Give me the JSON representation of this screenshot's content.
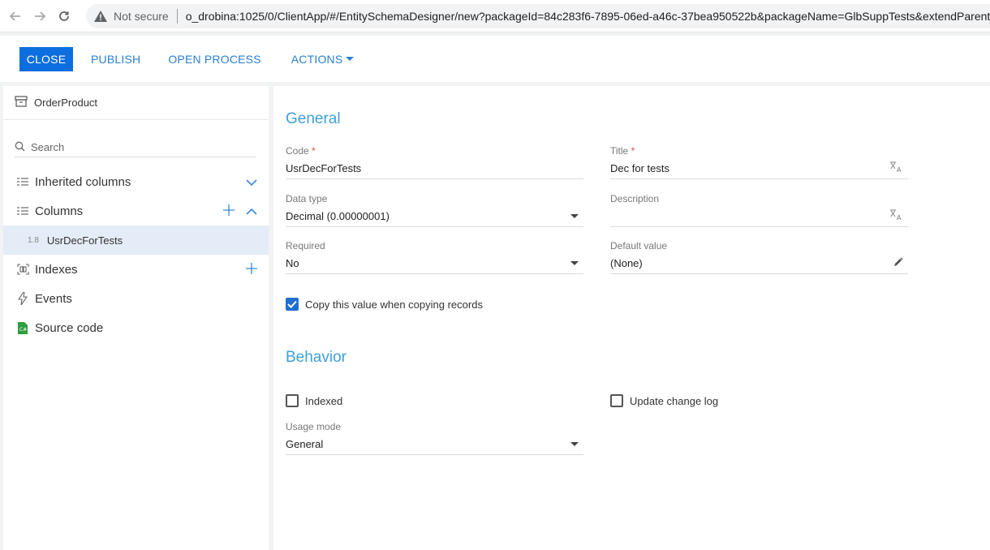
{
  "browser": {
    "not_secure_label": "Not secure",
    "url": "o_drobina:1025/0/ClientApp/#/EntitySchemaDesigner/new?packageId=84c283f6-7895-06ed-a46c-37bea950522b&packageName=GlbSuppTests&extendParent="
  },
  "toolbar": {
    "close_label": "CLOSE",
    "publish_label": "PUBLISH",
    "open_process_label": "OPEN PROCESS",
    "actions_label": "ACTIONS"
  },
  "sidebar": {
    "object_name": "OrderProduct",
    "search_placeholder": "Search",
    "items": [
      {
        "label": "Inherited columns"
      },
      {
        "label": "Columns"
      },
      {
        "label": "Indexes"
      },
      {
        "label": "Events"
      },
      {
        "label": "Source code"
      }
    ],
    "selected_column": {
      "number": "1.8",
      "label": "UsrDecForTests"
    }
  },
  "general": {
    "title": "General",
    "code": {
      "label": "Code",
      "required_mark": "*",
      "value": "UsrDecForTests"
    },
    "title_field": {
      "label": "Title",
      "required_mark": "*",
      "value": "Dec for tests"
    },
    "data_type": {
      "label": "Data type",
      "value": "Decimal (0.00000001)"
    },
    "description": {
      "label": "Description",
      "value": ""
    },
    "required": {
      "label": "Required",
      "value": "No"
    },
    "default_value": {
      "label": "Default value",
      "value": "(None)"
    },
    "copy_value": {
      "label": "Copy this value when copying records",
      "checked": true
    }
  },
  "behavior": {
    "title": "Behavior",
    "indexed": {
      "label": "Indexed",
      "checked": false
    },
    "update_change_log": {
      "label": "Update change log",
      "checked": false
    },
    "usage_mode": {
      "label": "Usage mode",
      "value": "General"
    }
  },
  "colors": {
    "accent": "#0d6ee0",
    "section_title": "#3fa0d9",
    "required": "#e0483e",
    "selected_bg": "#e4ecf7"
  }
}
